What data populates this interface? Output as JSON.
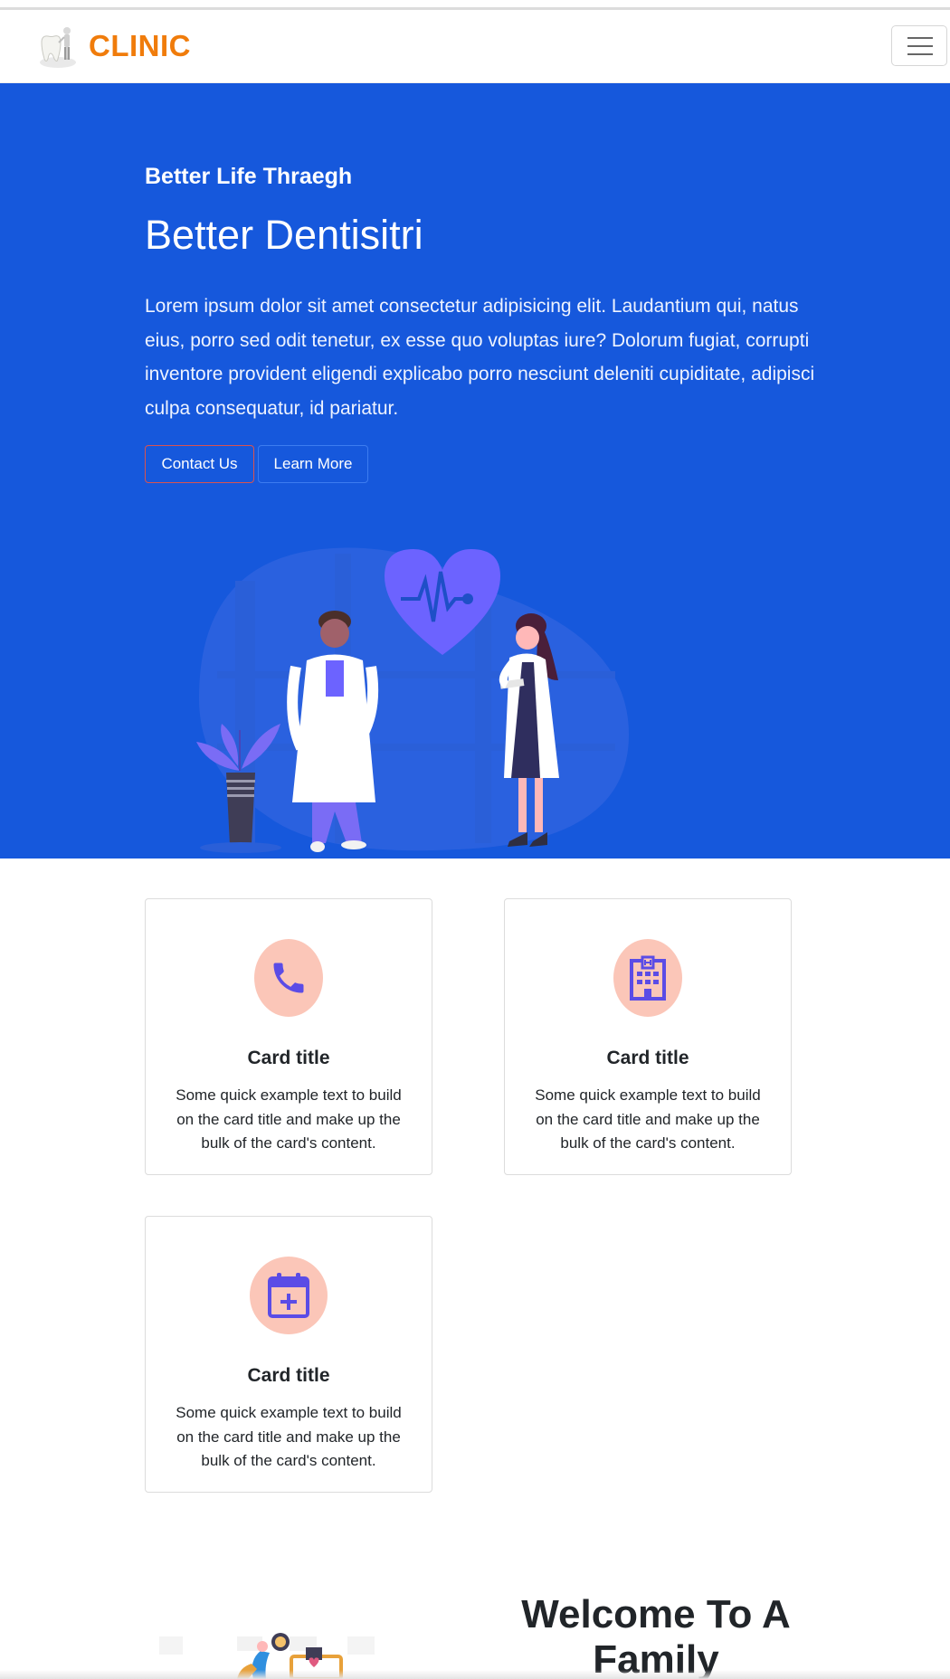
{
  "navbar": {
    "brand": "CLINIC"
  },
  "hero": {
    "eyebrow": "Better Life Thraegh",
    "title": "Better Dentisitri",
    "text": "Lorem ipsum dolor sit amet consectetur adipisicing elit. Laudantium qui, natus eius, porro sed odit tenetur, ex esse quo voluptas iure? Dolorum fugiat, corrupti inventore provident eligendi explicabo porro nesciunt deleniti cupiditate, adipisci culpa consequatur, id pariatur.",
    "contact_label": "Contact Us",
    "learn_label": "Learn More"
  },
  "cards": [
    {
      "icon": "phone-icon",
      "title": "Card title",
      "text": "Some quick example text to build on the card title and make up the bulk of the card's content."
    },
    {
      "icon": "hospital-icon",
      "title": "Card title",
      "text": "Some quick example text to build on the card title and make up the bulk of the card's content."
    },
    {
      "icon": "calendar-plus-icon",
      "title": "Card title",
      "text": "Some quick example text to build on the card title and make up the bulk of the card's content."
    }
  ],
  "welcome": {
    "title": "Welcome To A Family"
  },
  "colors": {
    "brand": "#f07c0b",
    "hero_bg": "#1658dc",
    "icon_circle": "#fbc6b8",
    "icon_fill": "#5b4ce6",
    "illustration_accent": "#6c63ff"
  }
}
